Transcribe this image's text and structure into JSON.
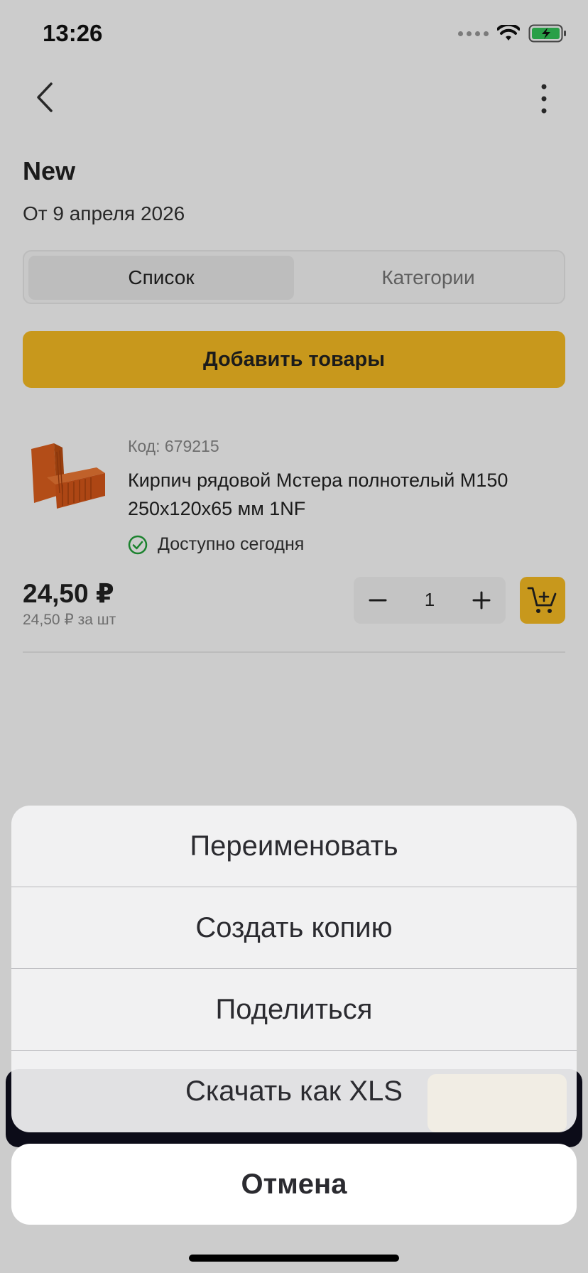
{
  "status_bar": {
    "time": "13:26"
  },
  "header": {
    "title": "New",
    "subtitle": "От 9 апреля 2026"
  },
  "tabs": [
    {
      "label": "Список",
      "active": true
    },
    {
      "label": "Категории",
      "active": false
    }
  ],
  "add_button": "Добавить товары",
  "product": {
    "code": "Код: 679215",
    "name": "Кирпич рядовой Мстера полнотелый М150 250х120х65 мм 1NF",
    "availability": "Доступно сегодня",
    "price": "24,50 ₽",
    "unit_price": "24,50 ₽ за шт",
    "quantity": "1"
  },
  "action_sheet": {
    "actions": [
      "Переименовать",
      "Создать копию",
      "Поделиться",
      "Скачать как XLS"
    ],
    "cancel": "Отмена"
  },
  "colors": {
    "accent": "#fbbf24",
    "available": "#22a33a",
    "sheet_text": "#2b2b30"
  }
}
